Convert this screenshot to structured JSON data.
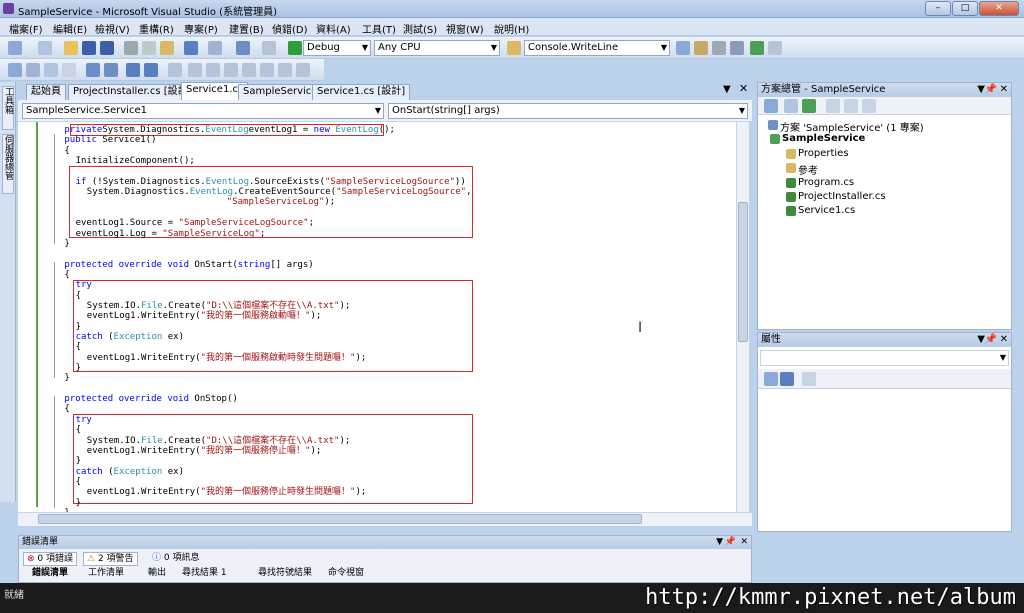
{
  "window": {
    "title": "SampleService - Microsoft Visual Studio (系統管理員)",
    "min": "–",
    "max": "□",
    "close": "✕"
  },
  "menu": [
    "檔案(F)",
    "編輯(E)",
    "檢視(V)",
    "重構(R)",
    "專案(P)",
    "建置(B)",
    "偵錯(D)",
    "資料(A)",
    "工具(T)",
    "測試(S)",
    "視窗(W)",
    "說明(H)"
  ],
  "toolbar": {
    "config": "Debug",
    "platform": "Any CPU",
    "find": "Console.WriteLine"
  },
  "left_strip": {
    "toolbox": "工具箱",
    "server_explorer": "伺服器總管"
  },
  "tabs": [
    "起始頁",
    "ProjectInstaller.cs [設計]",
    "Service1.cs",
    "SampleService",
    "Service1.cs [設計]"
  ],
  "active_tab": "Service1.cs",
  "navbar": {
    "class_combo": "SampleService.Service1",
    "member_combo": "OnStart(string[] args)"
  },
  "code_lines": [
    {
      "i": 4,
      "parts": [
        [
          "kw",
          "private"
        ],
        [
          "",
          "System.Diagnostics."
        ],
        [
          "ty",
          "EventLog"
        ],
        [
          "",
          "eventLog1 = "
        ],
        [
          "kw",
          "new "
        ],
        [
          "ty",
          "EventLog"
        ],
        [
          "",
          "();"
        ]
      ]
    },
    {
      "i": 4,
      "parts": [
        [
          "kw",
          "public"
        ],
        [
          "",
          " Service1()"
        ]
      ]
    },
    {
      "i": 4,
      "parts": [
        [
          "",
          "{"
        ]
      ]
    },
    {
      "i": 6,
      "parts": [
        [
          "",
          "InitializeComponent();"
        ]
      ]
    },
    {
      "i": 0,
      "parts": [
        [
          "",
          ""
        ]
      ]
    },
    {
      "i": 6,
      "parts": [
        [
          "kw",
          "if"
        ],
        [
          "",
          " (!System.Diagnostics."
        ],
        [
          "ty",
          "EventLog"
        ],
        [
          "",
          ".SourceExists("
        ],
        [
          "st",
          "\"SampleServiceLogSource\""
        ],
        [
          "",
          "))"
        ]
      ]
    },
    {
      "i": 8,
      "parts": [
        [
          "",
          "System.Diagnostics."
        ],
        [
          "ty",
          "EventLog"
        ],
        [
          "",
          ".CreateEventSource("
        ],
        [
          "st",
          "\"SampleServiceLogSource\""
        ],
        [
          "",
          ","
        ]
      ]
    },
    {
      "i": 33,
      "parts": [
        [
          "st",
          "\"SampleServiceLog\""
        ],
        [
          "",
          ");"
        ]
      ]
    },
    {
      "i": 0,
      "parts": [
        [
          "",
          ""
        ]
      ]
    },
    {
      "i": 6,
      "parts": [
        [
          "",
          "eventLog1.Source = "
        ],
        [
          "st",
          "\"SampleServiceLogSource\""
        ],
        [
          "",
          ";"
        ]
      ]
    },
    {
      "i": 6,
      "parts": [
        [
          "",
          "eventLog1.Log = "
        ],
        [
          "st",
          "\"SampleServiceLog\""
        ],
        [
          "",
          ";"
        ]
      ]
    },
    {
      "i": 4,
      "parts": [
        [
          "",
          "}"
        ]
      ]
    },
    {
      "i": 0,
      "parts": [
        [
          "",
          ""
        ]
      ]
    },
    {
      "i": 4,
      "parts": [
        [
          "kw",
          "protected override void"
        ],
        [
          "",
          " OnStart("
        ],
        [
          "kw",
          "string"
        ],
        [
          "",
          "[] args)"
        ]
      ]
    },
    {
      "i": 4,
      "parts": [
        [
          "",
          "{"
        ]
      ]
    },
    {
      "i": 6,
      "parts": [
        [
          "kw",
          "try"
        ]
      ]
    },
    {
      "i": 6,
      "parts": [
        [
          "",
          "{"
        ]
      ]
    },
    {
      "i": 8,
      "parts": [
        [
          "",
          "System.IO."
        ],
        [
          "ty",
          "File"
        ],
        [
          "",
          ".Create("
        ],
        [
          "st",
          "\"D:\\\\這個檔案不存在\\\\A.txt\""
        ],
        [
          "",
          ");"
        ]
      ]
    },
    {
      "i": 8,
      "parts": [
        [
          "",
          "eventLog1.WriteEntry("
        ],
        [
          "st",
          "\"我的第一個服務啟動囉！\""
        ],
        [
          "",
          ");"
        ]
      ]
    },
    {
      "i": 6,
      "parts": [
        [
          "",
          "}"
        ]
      ]
    },
    {
      "i": 6,
      "parts": [
        [
          "kw",
          "catch"
        ],
        [
          "",
          " ("
        ],
        [
          "ty",
          "Exception"
        ],
        [
          "",
          " ex)"
        ]
      ]
    },
    {
      "i": 6,
      "parts": [
        [
          "",
          "{"
        ]
      ]
    },
    {
      "i": 8,
      "parts": [
        [
          "",
          "eventLog1.WriteEntry("
        ],
        [
          "st",
          "\"我的第一個服務啟動時發生問題囉！\""
        ],
        [
          "",
          ");"
        ]
      ]
    },
    {
      "i": 6,
      "parts": [
        [
          "",
          "}"
        ]
      ]
    },
    {
      "i": 4,
      "parts": [
        [
          "",
          "}"
        ]
      ]
    },
    {
      "i": 0,
      "parts": [
        [
          "",
          ""
        ]
      ]
    },
    {
      "i": 4,
      "parts": [
        [
          "kw",
          "protected override void"
        ],
        [
          "",
          " OnStop()"
        ]
      ]
    },
    {
      "i": 4,
      "parts": [
        [
          "",
          "{"
        ]
      ]
    },
    {
      "i": 6,
      "parts": [
        [
          "kw",
          "try"
        ]
      ]
    },
    {
      "i": 6,
      "parts": [
        [
          "",
          "{"
        ]
      ]
    },
    {
      "i": 8,
      "parts": [
        [
          "",
          "System.IO."
        ],
        [
          "ty",
          "File"
        ],
        [
          "",
          ".Create("
        ],
        [
          "st",
          "\"D:\\\\這個檔案不存在\\\\A.txt\""
        ],
        [
          "",
          ");"
        ]
      ]
    },
    {
      "i": 8,
      "parts": [
        [
          "",
          "eventLog1.WriteEntry("
        ],
        [
          "st",
          "\"我的第一個服務停止囉！\""
        ],
        [
          "",
          ");"
        ]
      ]
    },
    {
      "i": 6,
      "parts": [
        [
          "",
          "}"
        ]
      ]
    },
    {
      "i": 6,
      "parts": [
        [
          "kw",
          "catch"
        ],
        [
          "",
          " ("
        ],
        [
          "ty",
          "Exception"
        ],
        [
          "",
          " ex)"
        ]
      ]
    },
    {
      "i": 6,
      "parts": [
        [
          "",
          "{"
        ]
      ]
    },
    {
      "i": 8,
      "parts": [
        [
          "",
          "eventLog1.WriteEntry("
        ],
        [
          "st",
          "\"我的第一個服務停止時發生問題囉！\""
        ],
        [
          "",
          ");"
        ]
      ]
    },
    {
      "i": 6,
      "parts": [
        [
          "",
          "}"
        ]
      ]
    },
    {
      "i": 4,
      "parts": [
        [
          "",
          "}"
        ]
      ]
    }
  ],
  "solution_explorer": {
    "title": "方案總管 - SampleService",
    "items": [
      "方案 'SampleService' (1 專案)",
      "SampleService",
      "Properties",
      "參考",
      "Program.cs",
      "ProjectInstaller.cs",
      "Service1.cs"
    ]
  },
  "properties": {
    "title": "屬性"
  },
  "error_list": {
    "title": "錯誤清單",
    "errors": "0 項錯誤",
    "warnings": "2 項警告",
    "messages": "0 項訊息"
  },
  "bottom_tabs": [
    "錯誤清單",
    "工作清單",
    "輸出",
    "尋找結果 1",
    "尋找符號結果",
    "命令視窗"
  ],
  "status": {
    "text": "就緒"
  },
  "watermark": "http://kmmr.pixnet.net/album"
}
